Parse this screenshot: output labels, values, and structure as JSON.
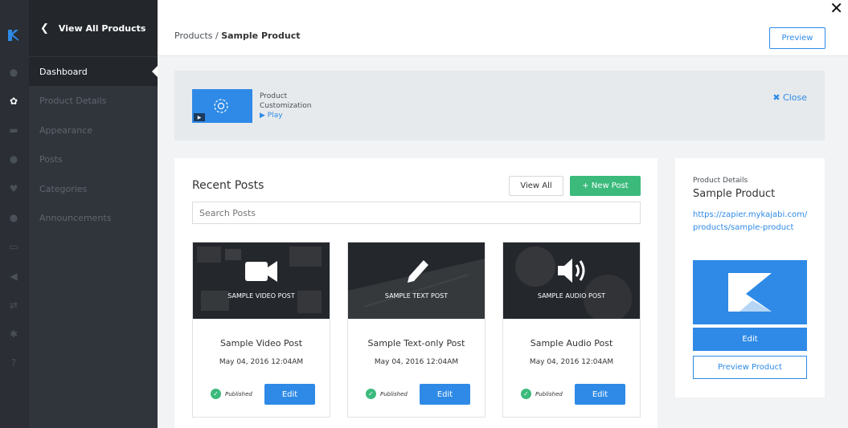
{
  "nav": {
    "back_label": "View All Products",
    "items": [
      {
        "label": "Dashboard"
      },
      {
        "label": "Product Details"
      },
      {
        "label": "Appearance"
      },
      {
        "label": "Posts"
      },
      {
        "label": "Categories"
      },
      {
        "label": "Announcements"
      }
    ]
  },
  "rail": {
    "icons": [
      "dashboard-icon",
      "products-icon",
      "cart-icon",
      "users-icon",
      "heart-icon",
      "chat-icon",
      "monitor-icon",
      "megaphone-icon",
      "shuffle-icon",
      "settings-icon",
      "help-icon"
    ]
  },
  "header": {
    "breadcrumb_prefix": "Products / ",
    "breadcrumb_current": "Sample Product",
    "preview_label": "Preview",
    "close_glyph": "✕"
  },
  "banner": {
    "line1": "Product",
    "line2": "Customization",
    "play_label": "▶ Play",
    "close_label": "✖ Close"
  },
  "recent_posts": {
    "title": "Recent Posts",
    "view_all_label": "View All",
    "new_post_label": "+ New Post",
    "search_placeholder": "Search Posts",
    "posts": [
      {
        "image_label": "SAMPLE VIDEO POST",
        "title": "Sample Video Post",
        "date": "May 04, 2016 12:04AM",
        "status": "Published",
        "edit_label": "Edit",
        "icon": "video-camera-icon"
      },
      {
        "image_label": "SAMPLE TEXT POST",
        "title": "Sample Text-only Post",
        "date": "May 04, 2016 12:04AM",
        "status": "Published",
        "edit_label": "Edit",
        "icon": "pencil-icon"
      },
      {
        "image_label": "SAMPLE AUDIO POST",
        "title": "Sample Audio Post",
        "date": "May 04, 2016 12:04AM",
        "status": "Published",
        "edit_label": "Edit",
        "icon": "speaker-icon"
      }
    ]
  },
  "product": {
    "heading": "Product Details",
    "name": "Sample Product",
    "url": "https://zapier.mykajabi.com/products/sample-product",
    "edit_label": "Edit",
    "preview_label": "Preview Product"
  },
  "colors": {
    "accent": "#2e8ae6",
    "green": "#3bba7c",
    "sidebar": "#30353c",
    "rail": "#2b2f35"
  }
}
